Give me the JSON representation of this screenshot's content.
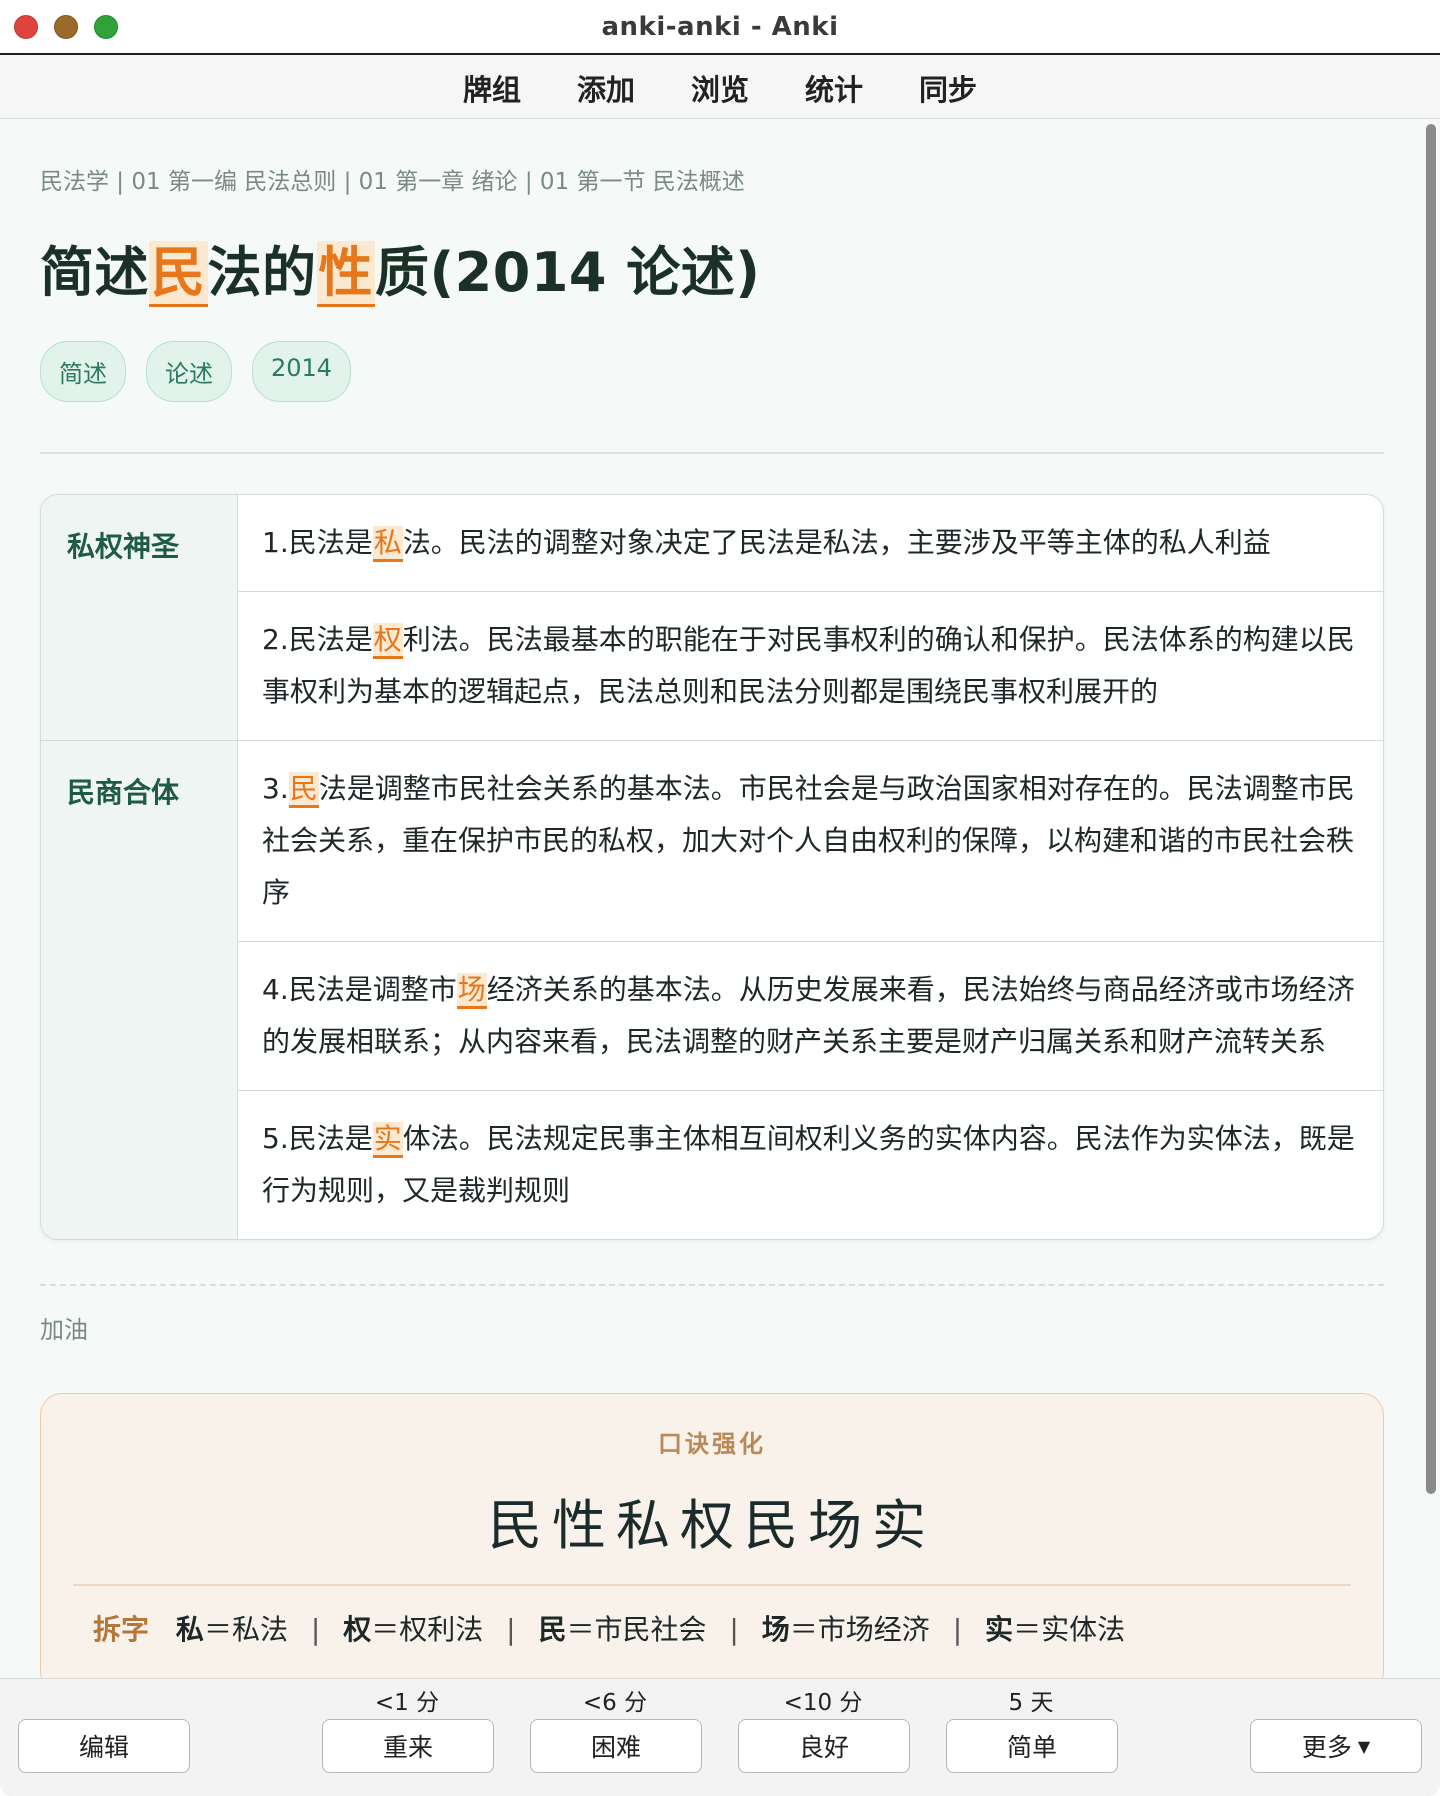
{
  "window": {
    "title": "anki-anki - Anki"
  },
  "toolbar": {
    "decks": "牌组",
    "add": "添加",
    "browse": "浏览",
    "stats": "统计",
    "sync": "同步"
  },
  "card": {
    "breadcrumb": "民法学 | 01 第一编 民法总则 | 01 第一章 绪论 | 01 第一节 民法概述",
    "title_parts": [
      "简述",
      "民",
      "法的",
      "性",
      "质(2014 论述)"
    ],
    "tags": [
      "简述",
      "论述",
      "2014"
    ],
    "table": [
      {
        "label": "私权神圣",
        "rows": [
          {
            "pre": "1.民法是",
            "key": "私",
            "post": "法。民法的调整对象决定了民法是私法，主要涉及平等主体的私人利益"
          },
          {
            "pre": "2.民法是",
            "key": "权",
            "post": "利法。民法最基本的职能在于对民事权利的确认和保护。民法体系的构建以民事权利为基本的逻辑起点，民法总则和民法分则都是围绕民事权利展开的"
          }
        ]
      },
      {
        "label": "民商合体",
        "rows": [
          {
            "pre": "3.",
            "key": "民",
            "post": "法是调整市民社会关系的基本法。市民社会是与政治国家相对存在的。民法调整市民社会关系，重在保护市民的私权，加大对个人自由权利的保障，以构建和谐的市民社会秩序"
          },
          {
            "pre": "4.民法是调整市",
            "key": "场",
            "post": "经济关系的基本法。从历史发展来看，民法始终与商品经济或市场经济的发展相联系；从内容来看，民法调整的财产关系主要是财产归属关系和财产流转关系"
          },
          {
            "pre": "5.民法是",
            "key": "实",
            "post": "体法。民法规定民事主体相互间权利义务的实体内容。民法作为实体法，既是行为规则，又是裁判规则"
          }
        ]
      }
    ],
    "cheer": "加油",
    "mnemonic": {
      "label": "口诀强化",
      "text": "民性私权民场实",
      "split_label": "拆字",
      "splits": [
        {
          "char": "私",
          "meaning": "＝私法"
        },
        {
          "char": "权",
          "meaning": "＝权利法"
        },
        {
          "char": "民",
          "meaning": "＝市民社会"
        },
        {
          "char": "场",
          "meaning": "＝市场经济"
        },
        {
          "char": "实",
          "meaning": "＝实体法"
        }
      ],
      "separator": "|"
    }
  },
  "answer_bar": {
    "edit": "编辑",
    "again": {
      "label": "重来",
      "interval": "<1 分"
    },
    "hard": {
      "label": "困难",
      "interval": "<6 分"
    },
    "good": {
      "label": "良好",
      "interval": "<10 分"
    },
    "easy": {
      "label": "简单",
      "interval": "5 天"
    },
    "more": "更多"
  }
}
